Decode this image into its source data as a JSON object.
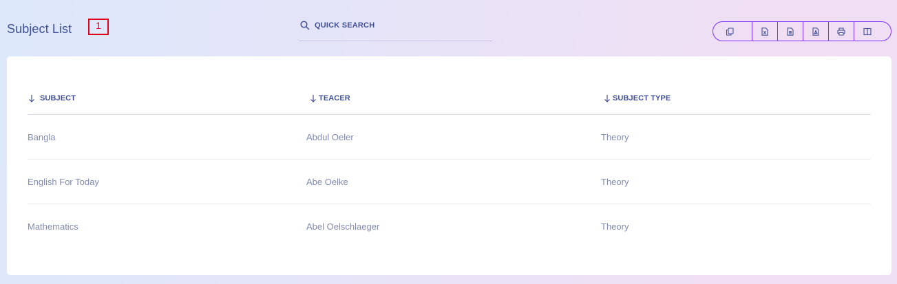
{
  "header": {
    "title": "Subject List",
    "count_badge": "1"
  },
  "search": {
    "placeholder": "QUICK SEARCH"
  },
  "export_buttons": [
    {
      "name": "copy",
      "icon": "copy-icon"
    },
    {
      "name": "excel",
      "icon": "excel-file-icon"
    },
    {
      "name": "csv",
      "icon": "csv-file-icon"
    },
    {
      "name": "pdf",
      "icon": "pdf-file-icon"
    },
    {
      "name": "print",
      "icon": "print-icon"
    },
    {
      "name": "columns",
      "icon": "columns-icon"
    }
  ],
  "table": {
    "columns": [
      "SUBJECT",
      "TEACER",
      "SUBJECT TYPE"
    ],
    "rows": [
      [
        "Bangla",
        "Abdul Oeler",
        "Theory"
      ],
      [
        "English For Today",
        "Abe Oelke",
        "Theory"
      ],
      [
        "Mathematics",
        "Abel Oelschlaeger",
        "Theory"
      ]
    ]
  },
  "colors": {
    "accent": "#7c32ff",
    "text_primary": "#415094",
    "text_secondary": "#828bb2",
    "badge_border": "#e0001a"
  }
}
